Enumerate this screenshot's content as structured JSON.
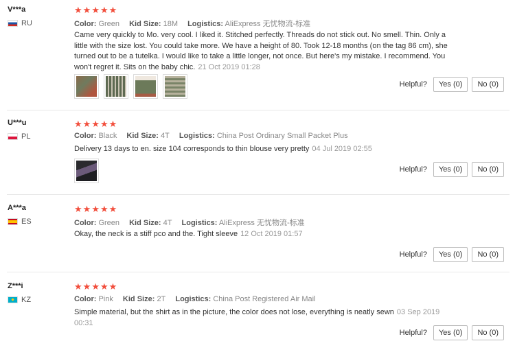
{
  "labels": {
    "color": "Color:",
    "kid_size": "Kid Size:",
    "logistics": "Logistics:",
    "helpful": "Helpful?"
  },
  "reviews": [
    {
      "user": "V***a",
      "country": "RU",
      "flag_colors": [
        "#ffffff",
        "#1c57a7",
        "#d52b1e"
      ],
      "rating": 5,
      "color": "Green",
      "kid_size": "18M",
      "logistics": "AliExpress 无忧物流-标准",
      "text": "Came very quickly to Mo. very cool. I liked it. Stitched perfectly. Threads do not stick out. No smell. Thin. Only a little with the size lost. You could take more. We have a height of 80. Took 12-18 months (on the tag 86 cm), she turned out to be a tutelka. I would like to take a little longer, not once. But here's my mistake. I recommend. You won't regret it. Sits on the baby chic.",
      "date": "21 Oct 2019 01:28",
      "photos": 4,
      "yes": "Yes (0)",
      "no": "No (0)"
    },
    {
      "user": "U***u",
      "country": "PL",
      "flag_colors": [
        "#ffffff",
        "#dc143c"
      ],
      "rating": 5,
      "color": "Black",
      "kid_size": "4T",
      "logistics": "China Post Ordinary Small Packet Plus",
      "text": "Delivery 13 days to en. size 104 corresponds to thin blouse very pretty",
      "date": "04 Jul 2019 02:55",
      "photos": 1,
      "yes": "Yes (0)",
      "no": "No (0)"
    },
    {
      "user": "A***a",
      "country": "ES",
      "flag_colors": [
        "#c60b1e",
        "#ffc400",
        "#c60b1e"
      ],
      "rating": 5,
      "color": "Green",
      "kid_size": "4T",
      "logistics": "AliExpress 无忧物流-标准",
      "text": "Okay, the neck is a stiff pco and the. Tight sleeve",
      "date": "12 Oct 2019 01:57",
      "photos": 0,
      "yes": "Yes (0)",
      "no": "No (0)"
    },
    {
      "user": "Z***i",
      "country": "KZ",
      "flag_colors": [
        "#00afca",
        "#fec50c"
      ],
      "rating": 5,
      "color": "Pink",
      "kid_size": "2T",
      "logistics": "China Post Registered Air Mail",
      "text": "Simple material, but the shirt as in the picture, the color does not lose, everything is neatly sewn",
      "date": "03 Sep 2019 00:31",
      "photos": 0,
      "yes": "Yes (0)",
      "no": "No (0)"
    }
  ]
}
